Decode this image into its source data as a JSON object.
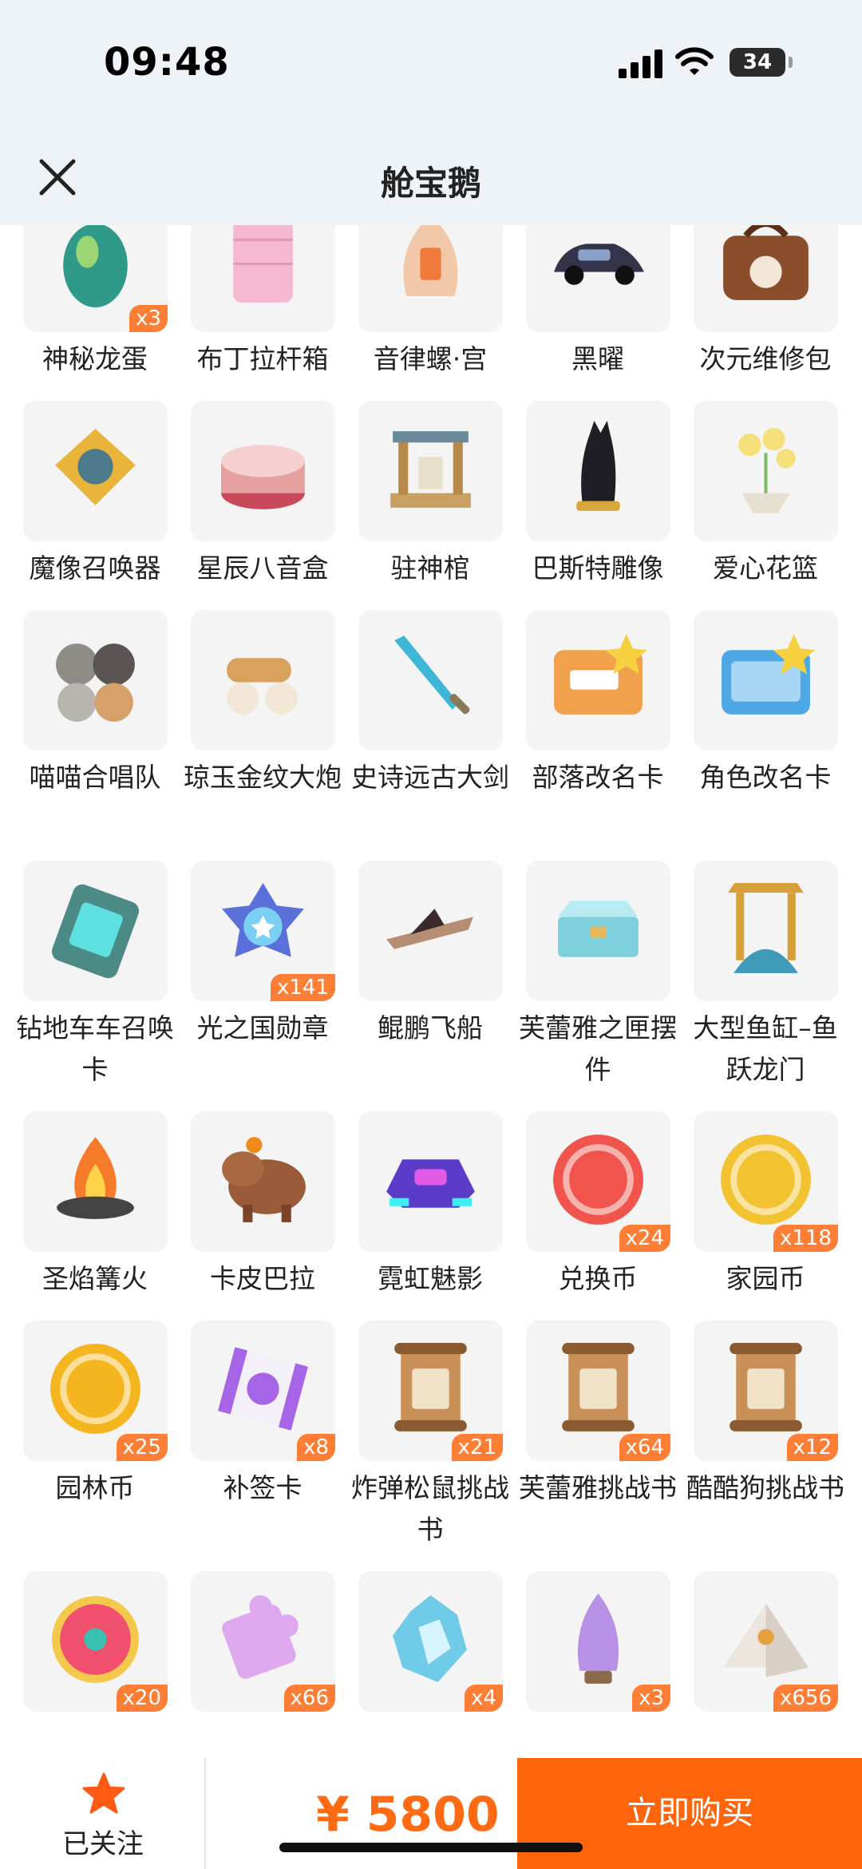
{
  "status_bar": {
    "time": "09:48",
    "battery": "34"
  },
  "header": {
    "title": "舱宝鹅"
  },
  "items": [
    {
      "name": "神秘龙蛋",
      "badge": "x3",
      "icon": "dragon-egg-icon",
      "color": "#2f9a8a"
    },
    {
      "name": "布丁拉杆箱",
      "badge": "",
      "icon": "suitcase-icon",
      "color": "#f4b8d0"
    },
    {
      "name": "音律螺·宫",
      "badge": "",
      "icon": "conch-icon",
      "color": "#f2c9a8"
    },
    {
      "name": "黑曜",
      "badge": "",
      "icon": "car-icon",
      "color": "#33344a"
    },
    {
      "name": "次元维修包",
      "badge": "",
      "icon": "repair-bag-icon",
      "color": "#8a4e2a"
    },
    {
      "name": "魔像召唤器",
      "badge": "",
      "icon": "golem-summoner-icon",
      "color": "#e9b43a"
    },
    {
      "name": "星辰八音盒",
      "badge": "",
      "icon": "music-box-icon",
      "color": "#e7a0a0"
    },
    {
      "name": "驻神棺",
      "badge": "",
      "icon": "shrine-icon",
      "color": "#c8a062"
    },
    {
      "name": "巴斯特雕像",
      "badge": "",
      "icon": "cat-statue-icon",
      "color": "#1e1e24"
    },
    {
      "name": "爱心花篮",
      "badge": "",
      "icon": "flower-basket-icon",
      "color": "#f4df78"
    },
    {
      "name": "喵喵合唱队",
      "badge": "",
      "icon": "cat-choir-icon",
      "color": "#8f8c88"
    },
    {
      "name": "琼玉金纹大炮",
      "badge": "",
      "icon": "cannon-icon",
      "color": "#d9a25c"
    },
    {
      "name": "史诗远古大剑",
      "badge": "",
      "icon": "sword-icon",
      "color": "#3fb6d6"
    },
    {
      "name": "部落改名卡",
      "badge": "",
      "icon": "rename-card-icon",
      "color": "#f1a04c"
    },
    {
      "name": "角色改名卡",
      "badge": "",
      "icon": "role-rename-card-icon",
      "color": "#4fa8e6"
    },
    {
      "name": "钻地车车召唤卡",
      "badge": "",
      "icon": "drill-card-icon",
      "color": "#4c8a86"
    },
    {
      "name": "光之国勋章",
      "badge": "x141",
      "icon": "medal-icon",
      "color": "#5a6fd8"
    },
    {
      "name": "鲲鹏飞船",
      "badge": "",
      "icon": "airship-icon",
      "color": "#b58d72"
    },
    {
      "name": "芙蕾雅之匣摆件",
      "badge": "",
      "icon": "box-icon",
      "color": "#7ed0dc"
    },
    {
      "name": "大型鱼缸–鱼跃龙门",
      "badge": "",
      "icon": "aquarium-icon",
      "color": "#3e9ab7"
    },
    {
      "name": "圣焰篝火",
      "badge": "",
      "icon": "bonfire-icon",
      "color": "#f57a2a"
    },
    {
      "name": "卡皮巴拉",
      "badge": "",
      "icon": "capybara-icon",
      "color": "#9a5b38"
    },
    {
      "name": "霓虹魅影",
      "badge": "",
      "icon": "neon-car-icon",
      "color": "#5a3cc8"
    },
    {
      "name": "兑换币",
      "badge": "x24",
      "icon": "coin-icon",
      "color": "#f0544c"
    },
    {
      "name": "家园币",
      "badge": "x118",
      "icon": "coin-icon",
      "color": "#f2c230"
    },
    {
      "name": "园林币",
      "badge": "x25",
      "icon": "coin-icon",
      "color": "#f5b51e"
    },
    {
      "name": "补签卡",
      "badge": "x8",
      "icon": "ticket-icon",
      "color": "#a565e6"
    },
    {
      "name": "炸弹松鼠挑战书",
      "badge": "x21",
      "icon": "wanted-scroll-icon",
      "color": "#c99058"
    },
    {
      "name": "芙蕾雅挑战书",
      "badge": "x64",
      "icon": "wanted-scroll-icon",
      "color": "#c99058"
    },
    {
      "name": "酷酷狗挑战书",
      "badge": "x12",
      "icon": "wanted-scroll-icon",
      "color": "#c99058"
    },
    {
      "name": "",
      "badge": "x20",
      "icon": "flower-plaque-icon",
      "color": "#f0506e"
    },
    {
      "name": "",
      "badge": "x66",
      "icon": "puzzle-icon",
      "color": "#dda8ee"
    },
    {
      "name": "",
      "badge": "x4",
      "icon": "crystal-icon",
      "color": "#62c6e8"
    },
    {
      "name": "",
      "badge": "x3",
      "icon": "hyacinth-icon",
      "color": "#b890e6"
    },
    {
      "name": "",
      "badge": "x656",
      "icon": "white-pyramid-icon",
      "color": "#ece6de"
    }
  ],
  "bottom_bar": {
    "follow_label": "已关注",
    "price": "¥ 5800",
    "buy_label": "立即购买"
  }
}
